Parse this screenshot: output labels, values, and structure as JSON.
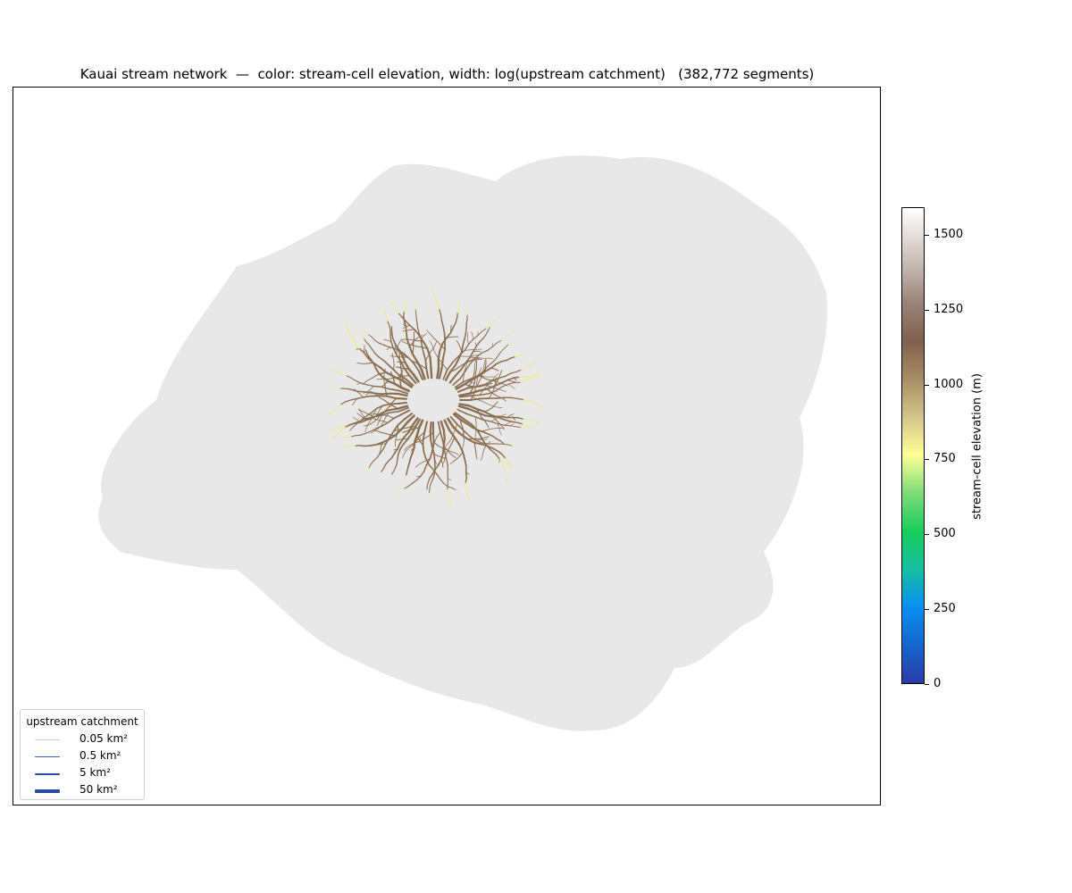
{
  "title": "Kauai stream network  —  color: stream-cell elevation, width: log(upstream catchment)   (382,772 segments)",
  "colorbar": {
    "label": "stream-cell elevation (m)",
    "ticks": [
      "0",
      "250",
      "500",
      "750",
      "1000",
      "1250",
      "1500"
    ],
    "range": [
      0,
      1590
    ],
    "colors": [
      "#2a3ba8",
      "#0a8ef0",
      "#19cc5c",
      "#ffff97",
      "#a88e64",
      "#80604e",
      "#ffffff"
    ]
  },
  "legend": {
    "title": "upstream catchment",
    "items": [
      {
        "label": "0.05 km²",
        "color": "#c8d0e8"
      },
      {
        "label": "0.5 km²",
        "color": "#3a5fb0"
      },
      {
        "label": "5 km²",
        "color": "#2a4aa8"
      },
      {
        "label": "50 km²",
        "color": "#2a4aa8"
      }
    ]
  },
  "map": {
    "land_color": "#e8e8e8",
    "stream_colors": {
      "low": "#2a3ba8",
      "mid": "#0a8ef0",
      "green": "#19cc5c",
      "yellow": "#e8f08a",
      "brown": "#8b6e50"
    }
  }
}
